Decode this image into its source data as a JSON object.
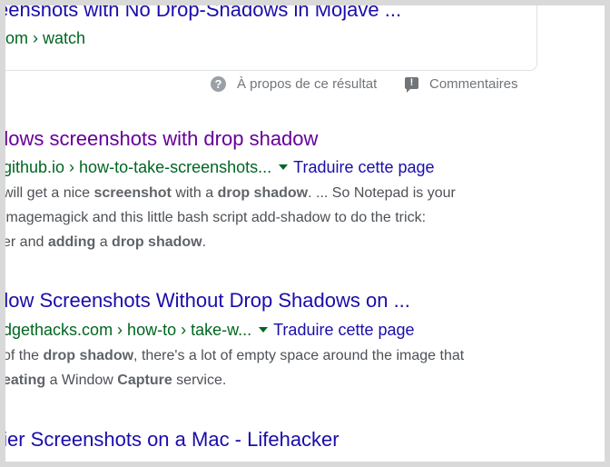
{
  "card": {
    "title": "eenshots with No Drop-Shadows in Mojave ...",
    "url": "om › watch"
  },
  "feedback": {
    "about": "À propos de ce résultat",
    "comments": "Commentaires"
  },
  "results": [
    {
      "title": "dows screenshots with drop shadow",
      "url": "github.io › how-to-take-screenshots...",
      "translate": "Traduire cette page",
      "lines": [
        [
          {
            "t": "will get a nice ",
            "b": false
          },
          {
            "t": "screenshot",
            "b": true
          },
          {
            "t": " with a ",
            "b": false
          },
          {
            "t": "drop shadow",
            "b": true
          },
          {
            "t": ". ... So Notepad is your",
            "b": false
          }
        ],
        [
          {
            "t": " imagemagick and this little bash script add-shadow to do the trick:",
            "b": false
          }
        ],
        [
          {
            "t": "er and ",
            "b": false
          },
          {
            "t": "adding",
            "b": true
          },
          {
            "t": " a ",
            "b": false
          },
          {
            "t": "drop shadow",
            "b": true
          },
          {
            "t": ".",
            "b": false
          }
        ]
      ]
    },
    {
      "title": "dow Screenshots Without Drop Shadows on ...",
      "url": "dgethacks.com › how-to › take-w...",
      "translate": "Traduire cette page",
      "lines": [
        [
          {
            "t": "of the ",
            "b": false
          },
          {
            "t": "drop shadow",
            "b": true
          },
          {
            "t": ", there's a lot of empty space around the image that",
            "b": false
          }
        ],
        [
          {
            "t": "eating",
            "b": true
          },
          {
            "t": " a Window ",
            "b": false
          },
          {
            "t": "Capture",
            "b": true
          },
          {
            "t": " service.",
            "b": false
          }
        ]
      ]
    },
    {
      "title": "tier Screenshots on a Mac - Lifehacker"
    }
  ],
  "icons": {
    "about": "help-circle-icon",
    "comments": "feedback-icon",
    "dropdown": "caret-down-icon"
  },
  "colors": {
    "link": "#1a0dab",
    "visited": "#660099",
    "url": "#006621",
    "snippet": "#4d5156",
    "meta": "#70757a"
  }
}
